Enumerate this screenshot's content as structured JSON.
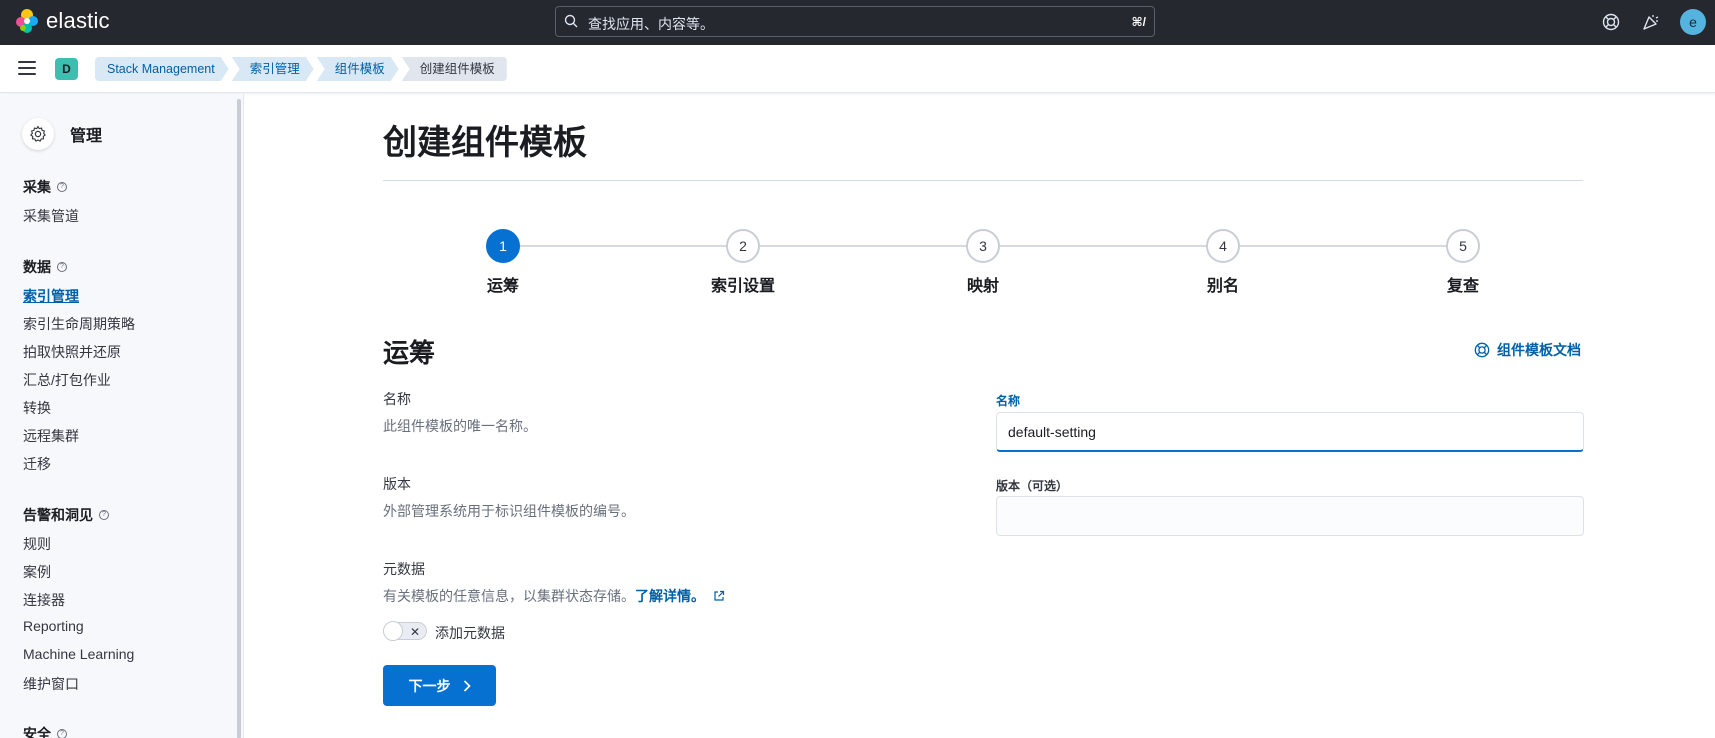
{
  "topbar": {
    "logo_text": "elastic",
    "search_placeholder": "查找应用、内容等。",
    "search_shortcut": "⌘/",
    "user_initial": "e"
  },
  "subbar": {
    "space_initial": "D",
    "breadcrumbs": [
      "Stack Management",
      "索引管理",
      "组件模板",
      "创建组件模板"
    ]
  },
  "sidebar": {
    "title": "管理",
    "groups": [
      {
        "label": "采集",
        "items": [
          "采集管道"
        ]
      },
      {
        "label": "数据",
        "items": [
          "索引管理",
          "索引生命周期策略",
          "拍取快照并还原",
          "汇总/打包作业",
          "转换",
          "远程集群",
          "迁移"
        ]
      },
      {
        "label": "告警和洞见",
        "items": [
          "规则",
          "案例",
          "连接器",
          "Reporting",
          "Machine Learning",
          "维护窗口"
        ]
      },
      {
        "label": "安全",
        "items": []
      }
    ],
    "active_item": "索引管理"
  },
  "main": {
    "page_title": "创建组件模板",
    "steps": [
      {
        "number": "1",
        "label": "运筹"
      },
      {
        "number": "2",
        "label": "索引设置"
      },
      {
        "number": "3",
        "label": "映射"
      },
      {
        "number": "4",
        "label": "别名"
      },
      {
        "number": "5",
        "label": "复查"
      }
    ],
    "active_step": 1,
    "section_title": "运筹",
    "docs_link": "组件模板文档",
    "fields": {
      "name": {
        "title": "名称",
        "description": "此组件模板的唯一名称。",
        "label": "名称",
        "value": "default-setting"
      },
      "version": {
        "title": "版本",
        "description": "外部管理系统用于标识组件模板的编号。",
        "label": "版本（可选）",
        "value": ""
      },
      "metadata": {
        "title": "元数据",
        "description": "有关模板的任意信息，以集群状态存储。",
        "learn_more": "了解详情。",
        "toggle_label": "添加元数据",
        "toggle_on": false
      }
    },
    "next_button": "下一步"
  },
  "colors": {
    "primary": "#0771d1",
    "link": "#0061a6",
    "header_bg": "#25282f"
  }
}
